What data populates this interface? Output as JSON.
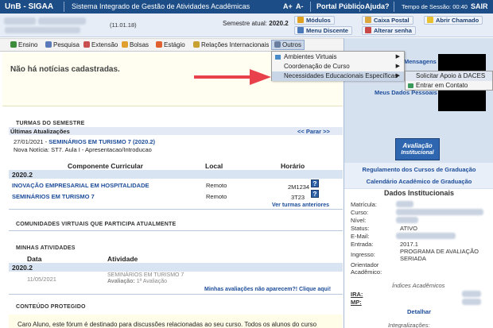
{
  "topbar": {
    "app_title": "UnB - SIGAA",
    "subtitle": "Sistema Integrado de Gestão de Atividades Acadêmicas",
    "font_inc": "A+",
    "font_dec": "A-",
    "portal": "Portal Público",
    "help": "Ajuda?",
    "session_label": "Tempo de Sessão: 00:40",
    "exit": "SAIR"
  },
  "userband": {
    "code": "(11.01.18)",
    "semester_label": "Semestre atual:",
    "semester_value": "2020.2",
    "buttons": {
      "modulos": "Módulos",
      "caixa_postal": "Caixa Postal",
      "abrir_chamado": "Abrir Chamado",
      "menu_discente": "Menu Discente",
      "alterar_senha": "Alterar senha"
    }
  },
  "menubar": {
    "items": [
      "Ensino",
      "Pesquisa",
      "Extensão",
      "Bolsas",
      "Estágio",
      "Relações Internacionais",
      "Outros"
    ]
  },
  "dropdown": {
    "items": [
      "Ambientes Virtuais",
      "Coordenação de Curso",
      "Necessidades Educacionais Específicas"
    ],
    "submenu": [
      "Solicitar Apoio à DACES",
      "Entrar em Contato"
    ]
  },
  "notices": {
    "empty": "Não há notícias cadastradas."
  },
  "turmas": {
    "title": "Turmas do Semestre",
    "updates_label": "Últimas Atualizações",
    "stop_link": "<< Parar >>",
    "update_date": "27/01/2021",
    "update_dash": " - ",
    "update_course": "SEMINÁRIOS EM TURISMO 7 (2020.2)",
    "update_note": "Nova Notícia: ST7. Aula I - Apresentacao/Introducao",
    "headers": [
      "Componente Curricular",
      "Local",
      "Horário"
    ],
    "semester": "2020.2",
    "rows": [
      {
        "name": "INOVAÇÃO EMPRESARIAL EM HOSPITALIDADE",
        "local": "Remoto",
        "time": "2M1234"
      },
      {
        "name": "SEMINÁRIOS EM TURISMO 7",
        "local": "Remoto",
        "time": "3T23"
      }
    ],
    "see_previous": "Ver turmas anteriores"
  },
  "comunidades": {
    "title": "Comunidades virtuais que participa atualmente"
  },
  "atividades": {
    "title": "Minhas atividades",
    "headers": [
      "Data",
      "Atividade"
    ],
    "semester": "2020.2",
    "row_date": "11/05/2021",
    "row_course": "SEMINÁRIOS EM TURISMO 7",
    "row_eval_label": "Avaliação:",
    "row_eval_value": " 1ª Avaliação",
    "missing_link": "Minhas avaliações não aparecem?! Clique aqui!"
  },
  "conteudo": {
    "title": "Conteúdo protegido",
    "text": "Caro Aluno, este fórum é destinado para discussões relacionadas ao seu curso. Todos os alunos do curso"
  },
  "rightpanel": {
    "messages": "Mensagens",
    "personal_data": "Meus Dados Pessoais",
    "badge_line1": "Avaliação",
    "badge_line2": "Institucional",
    "regulamento": "Regulamento dos Cursos de Graduação",
    "calendario": "Calendário Acadêmico de Graduação",
    "institutional_title": "Dados Institucionais",
    "fields": {
      "matricula": "Matrícula:",
      "curso": "Curso:",
      "nivel": "Nível:",
      "status": "Status:",
      "email": "E-Mail:",
      "entrada": "Entrada:",
      "ingresso": "Ingresso:",
      "orientador": "Orientador Acadêmico:"
    },
    "values": {
      "status": "ATIVO",
      "entrada": "2017.1",
      "ingresso": "PROGRAMA DE AVALIAÇÃO SERIADA"
    },
    "indices_title": "Índices Acadêmicos",
    "ira": "IRA:",
    "mp": "MP:",
    "detalhar": "Detalhar",
    "integralizacoes": "Integralizações:"
  },
  "colors": {
    "topbar": "#1d4d86",
    "link": "#1d4d9a",
    "panel": "#d6e1f0",
    "arrow": "#e8414b"
  }
}
